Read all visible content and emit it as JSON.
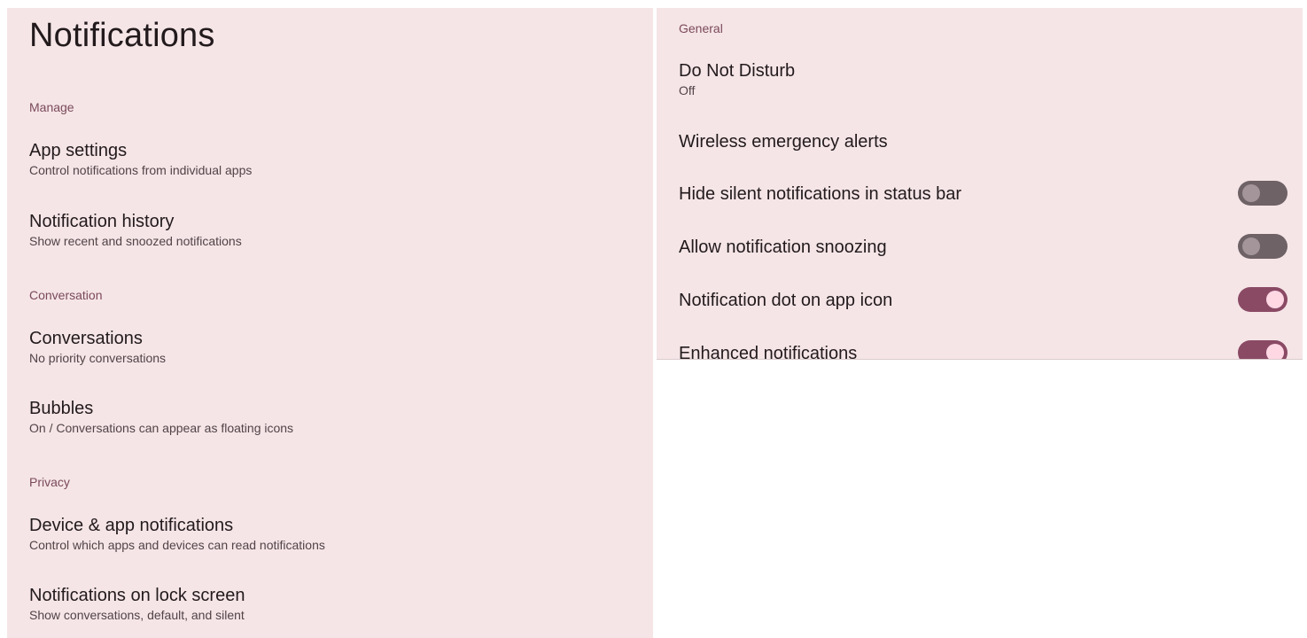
{
  "left": {
    "title": "Notifications",
    "sections": {
      "manage": "Manage",
      "conversation": "Conversation",
      "privacy": "Privacy"
    },
    "items": {
      "app_settings": {
        "title": "App settings",
        "summary": "Control notifications from individual apps"
      },
      "notification_history": {
        "title": "Notification history",
        "summary": "Show recent and snoozed notifications"
      },
      "conversations": {
        "title": "Conversations",
        "summary": "No priority conversations"
      },
      "bubbles": {
        "title": "Bubbles",
        "summary": "On / Conversations can appear as floating icons"
      },
      "device_app_notifications": {
        "title": "Device & app notifications",
        "summary": "Control which apps and devices can read notifications"
      },
      "lock_screen": {
        "title": "Notifications on lock screen",
        "summary": "Show conversations, default, and silent"
      }
    }
  },
  "right": {
    "section": "General",
    "items": {
      "dnd": {
        "title": "Do Not Disturb",
        "summary": "Off"
      },
      "wea": {
        "title": "Wireless emergency alerts"
      },
      "hide_silent": {
        "title": "Hide silent notifications in status bar",
        "toggle": "off"
      },
      "snoozing": {
        "title": "Allow notification snoozing",
        "toggle": "off"
      },
      "dot": {
        "title": "Notification dot on app icon",
        "toggle": "on"
      },
      "enhanced": {
        "title": "Enhanced notifications",
        "toggle": "on"
      }
    }
  },
  "colors": {
    "panel_bg": "#f5e5e7",
    "accent": "#7b4a5b",
    "toggle_on": "#8a4a64",
    "toggle_off": "#6e6266"
  }
}
